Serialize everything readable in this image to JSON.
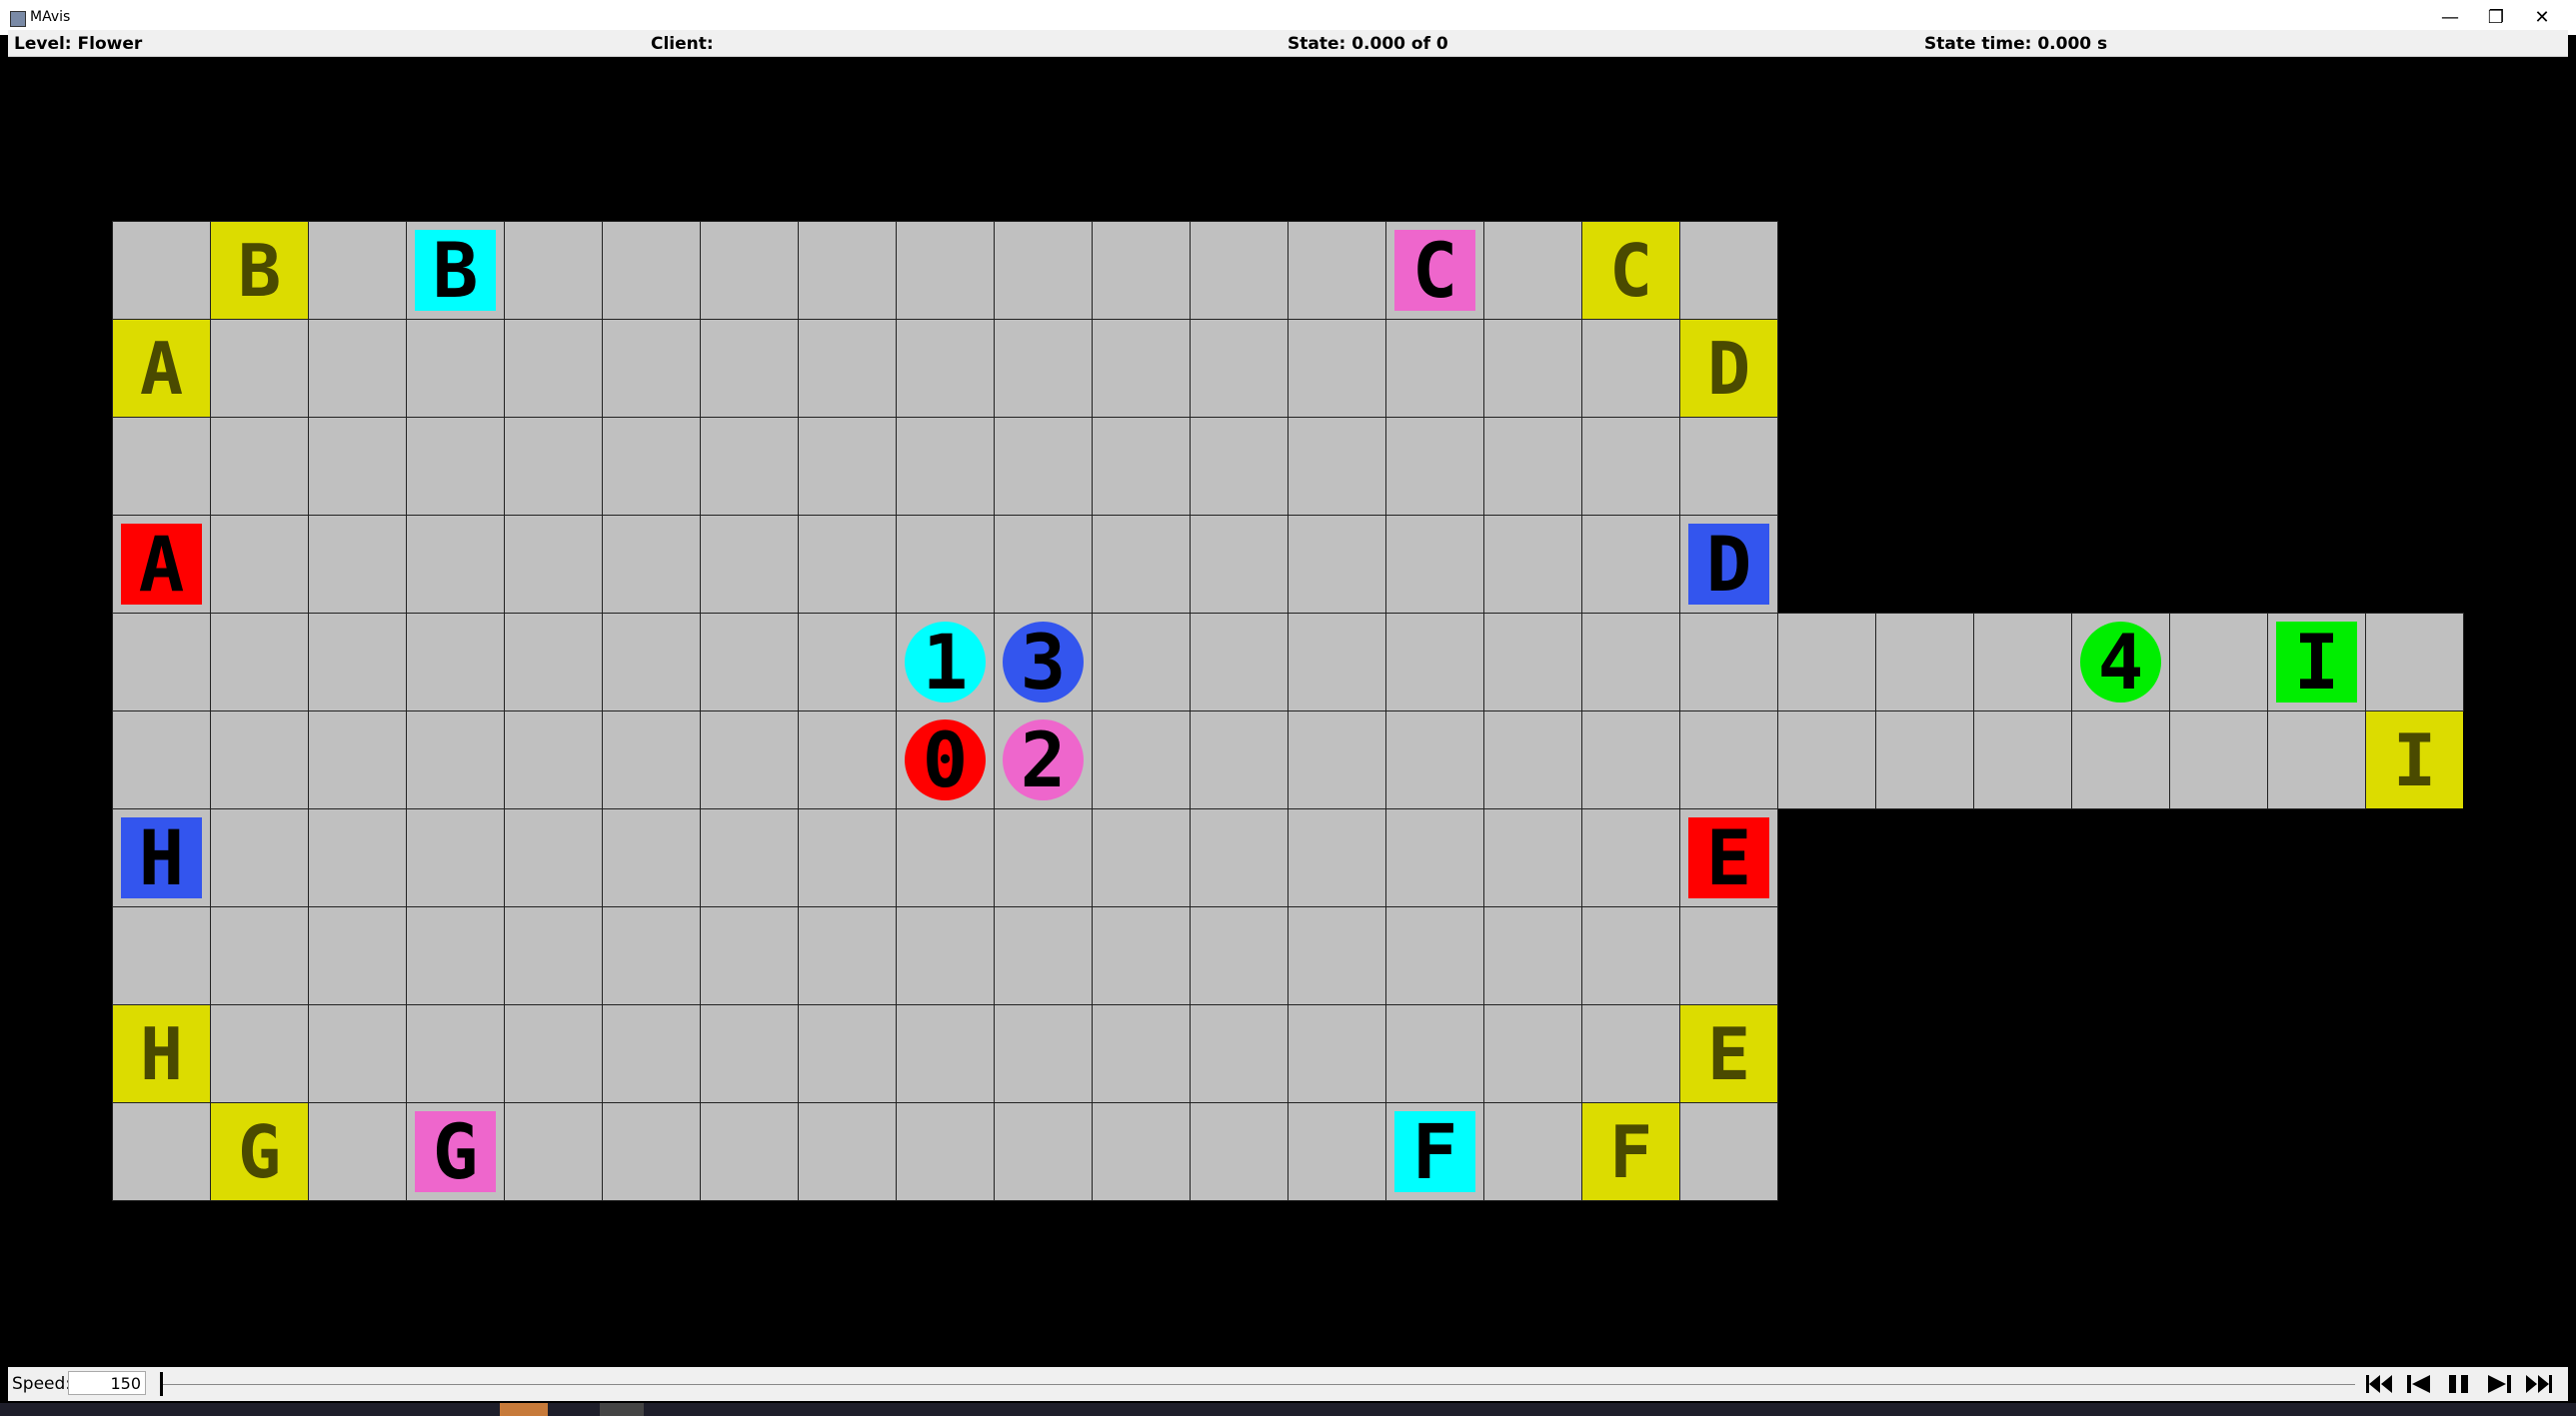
{
  "window": {
    "title": "MAvis",
    "minimize": "—",
    "restore": "❐",
    "close": "✕"
  },
  "info": {
    "level": "Level: Flower",
    "client": "Client:",
    "state": "State: 0.000 of 0",
    "state_time": "State time: 0.000 s"
  },
  "colors": {
    "floor": "#c0c0c0",
    "background": "#000000",
    "goal": "#dcdc00",
    "red": "#ff0000",
    "blue": "#3355ee",
    "cyan": "#00ffff",
    "magenta": "#ee66cc",
    "green": "#00ee00"
  },
  "level": {
    "floor": [
      ".................",
      ".................",
      ".................",
      ".................",
      "........................",
      ".......................",
      ".................",
      ".................",
      ".................",
      "................."
    ],
    "goals": [
      {
        "label": "B",
        "row": 0,
        "col": 1
      },
      {
        "label": "C",
        "row": 0,
        "col": 15
      },
      {
        "label": "A",
        "row": 1,
        "col": 0
      },
      {
        "label": "D",
        "row": 1,
        "col": 16
      },
      {
        "label": "I",
        "row": 5,
        "col": 23
      },
      {
        "label": "H",
        "row": 8,
        "col": 0
      },
      {
        "label": "E",
        "row": 8,
        "col": 16
      },
      {
        "label": "G",
        "row": 9,
        "col": 1
      },
      {
        "label": "F",
        "row": 9,
        "col": 15
      }
    ],
    "boxes": [
      {
        "label": "B",
        "row": 0,
        "col": 3,
        "color": "cyan"
      },
      {
        "label": "C",
        "row": 0,
        "col": 13,
        "color": "magenta"
      },
      {
        "label": "A",
        "row": 3,
        "col": 0,
        "color": "red"
      },
      {
        "label": "D",
        "row": 3,
        "col": 16,
        "color": "blue"
      },
      {
        "label": "I",
        "row": 4,
        "col": 22,
        "color": "green"
      },
      {
        "label": "H",
        "row": 6,
        "col": 0,
        "color": "blue"
      },
      {
        "label": "E",
        "row": 6,
        "col": 16,
        "color": "red"
      },
      {
        "label": "G",
        "row": 9,
        "col": 3,
        "color": "magenta"
      },
      {
        "label": "F",
        "row": 9,
        "col": 13,
        "color": "cyan"
      }
    ],
    "agents": [
      {
        "label": "1",
        "row": 4,
        "col": 8,
        "color": "cyan"
      },
      {
        "label": "3",
        "row": 4,
        "col": 9,
        "color": "blue"
      },
      {
        "label": "4",
        "row": 4,
        "col": 20,
        "color": "green"
      },
      {
        "label": "0",
        "row": 5,
        "col": 8,
        "color": "red"
      },
      {
        "label": "2",
        "row": 5,
        "col": 9,
        "color": "magenta"
      }
    ]
  },
  "controls": {
    "speed_label": "Speed:",
    "speed_value": "150",
    "timeline_position": 0,
    "buttons": [
      "skip-to-start-icon",
      "step-back-icon",
      "pause-icon",
      "step-forward-icon",
      "skip-to-end-icon"
    ]
  }
}
